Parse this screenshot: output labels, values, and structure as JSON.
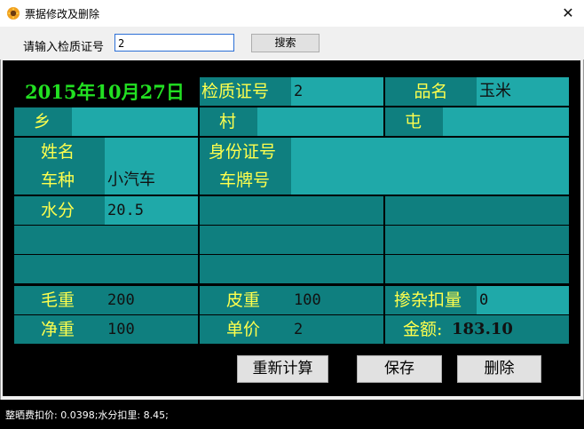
{
  "window": {
    "title": "票据修改及删除",
    "close_symbol": "✕"
  },
  "search": {
    "label": "请输入检质证号",
    "value": "2",
    "button": "搜索"
  },
  "record": {
    "date": "2015年10月27日",
    "cert_label": "检质证号",
    "cert_value": "2",
    "product_label": "品名",
    "product_value": "玉米",
    "township_label": "乡",
    "township_value": "",
    "village_label": "村",
    "village_value": "",
    "hamlet_label": "屯",
    "hamlet_value": "",
    "name_label": "姓名",
    "name_value": "",
    "id_label": "身份证号",
    "id_value": "",
    "vehicle_label": "车种",
    "vehicle_value": "小汽车",
    "plate_label": "车牌号",
    "plate_value": "",
    "moisture_label": "水分",
    "moisture_value": "20.5",
    "gross_label": "毛重",
    "gross_value": "200",
    "tare_label": "皮重",
    "tare_value": "100",
    "impurity_label": "掺杂扣量",
    "impurity_value": "0",
    "net_label": "净重",
    "net_value": "100",
    "price_label": "单价",
    "price_value": "2",
    "amount_label": "金额:",
    "amount_value": "183.10"
  },
  "actions": {
    "recalc": "重新计算",
    "save": "保存",
    "delete": "删除"
  },
  "status": {
    "text": "整晒费扣价: 0.0398;水分扣里: 8.45;"
  },
  "colors": {
    "dark_cell": "#0f7f7f",
    "light_cell": "#1fa9a9",
    "label_text": "#ffff4d",
    "date_text": "#22e022",
    "panel_bg": "#000000"
  }
}
